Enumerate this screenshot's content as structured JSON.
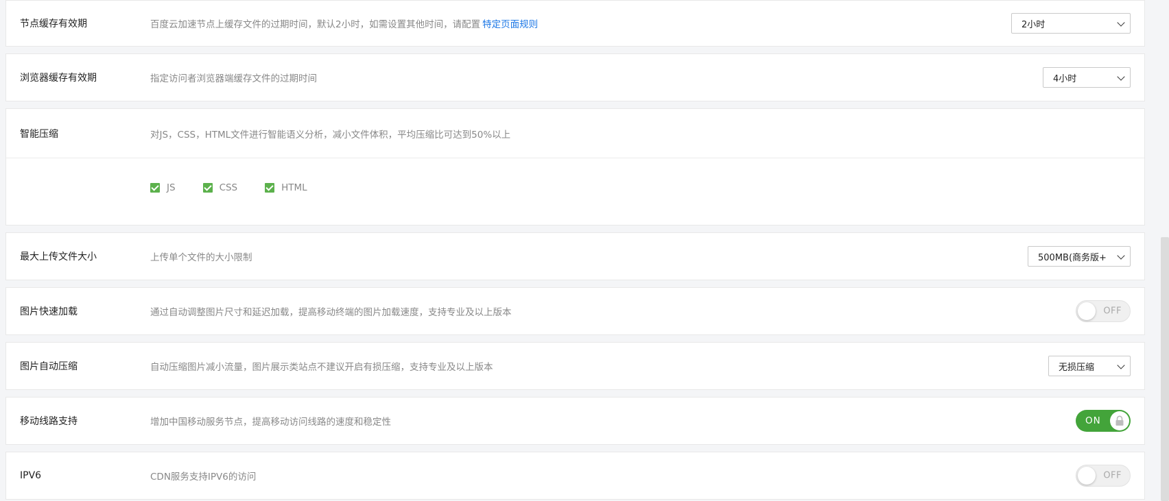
{
  "rows": {
    "node_cache": {
      "label": "节点缓存有效期",
      "desc": "百度云加速节点上缓存文件的过期时间，默认2小时，如需设置其他时间，请配置",
      "link": "特定页面规则",
      "value": "2小时"
    },
    "browser_cache": {
      "label": "浏览器缓存有效期",
      "desc": "指定访问者浏览器端缓存文件的过期时间",
      "value": "4小时"
    },
    "smart_compress": {
      "label": "智能压缩",
      "desc": "对JS，CSS，HTML文件进行智能语义分析，减小文件体积，平均压缩比可达到50%以上",
      "options": [
        {
          "label": "JS",
          "checked": true
        },
        {
          "label": "CSS",
          "checked": true
        },
        {
          "label": "HTML",
          "checked": true
        }
      ]
    },
    "max_upload": {
      "label": "最大上传文件大小",
      "desc": "上传单个文件的大小限制",
      "value": "500MB(商务版+"
    },
    "image_fast_load": {
      "label": "图片快速加载",
      "desc": "通过自动调整图片尺寸和延迟加载，提高移动终端的图片加载速度，支持专业及以上版本",
      "toggle": "OFF"
    },
    "image_auto_compress": {
      "label": "图片自动压缩",
      "desc": "自动压缩图片减小流量，图片展示类站点不建议开启有损压缩，支持专业及以上版本",
      "value": "无损压缩"
    },
    "mobile_line": {
      "label": "移动线路支持",
      "desc": "增加中国移动服务节点，提高移动访问线路的速度和稳定性",
      "toggle": "ON"
    },
    "ipv6": {
      "label": "IPV6",
      "desc": "CDN服务支持IPV6的访问",
      "toggle": "OFF"
    }
  },
  "colors": {
    "accent_green": "#43a43a",
    "link_blue": "#1e78e6"
  },
  "icons": {
    "lock": "lock-icon",
    "dropdown": "chevron-down-icon",
    "check": "checkbox-checked-icon"
  }
}
